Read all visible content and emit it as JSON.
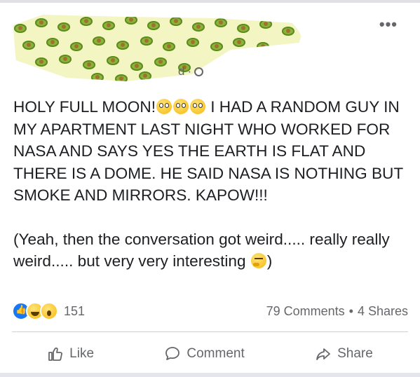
{
  "header": {
    "time": "d",
    "separator": "·",
    "privacy_icon": "globe-icon",
    "more_label": "•••"
  },
  "post": {
    "line1_a": "HOLY FULL MOON!",
    "line1_b": " I HAD A RANDOM GUY IN MY APARTMENT LAST NIGHT WHO WORKED FOR NASA AND SAYS YES THE EARTH IS FLAT AND THERE IS A DOME. HE SAID NASA IS NOTHING BUT SMOKE AND MIRRORS. KAPOW!!!",
    "para2_a": "(Yeah, then the conversation got weird..... really really weird..... but very very interesting ",
    "para2_b": ")"
  },
  "stats": {
    "reaction_count": "151",
    "comments": "79 Comments",
    "dot": "•",
    "shares": "4 Shares"
  },
  "actions": {
    "like": "Like",
    "comment": "Comment",
    "share": "Share"
  }
}
